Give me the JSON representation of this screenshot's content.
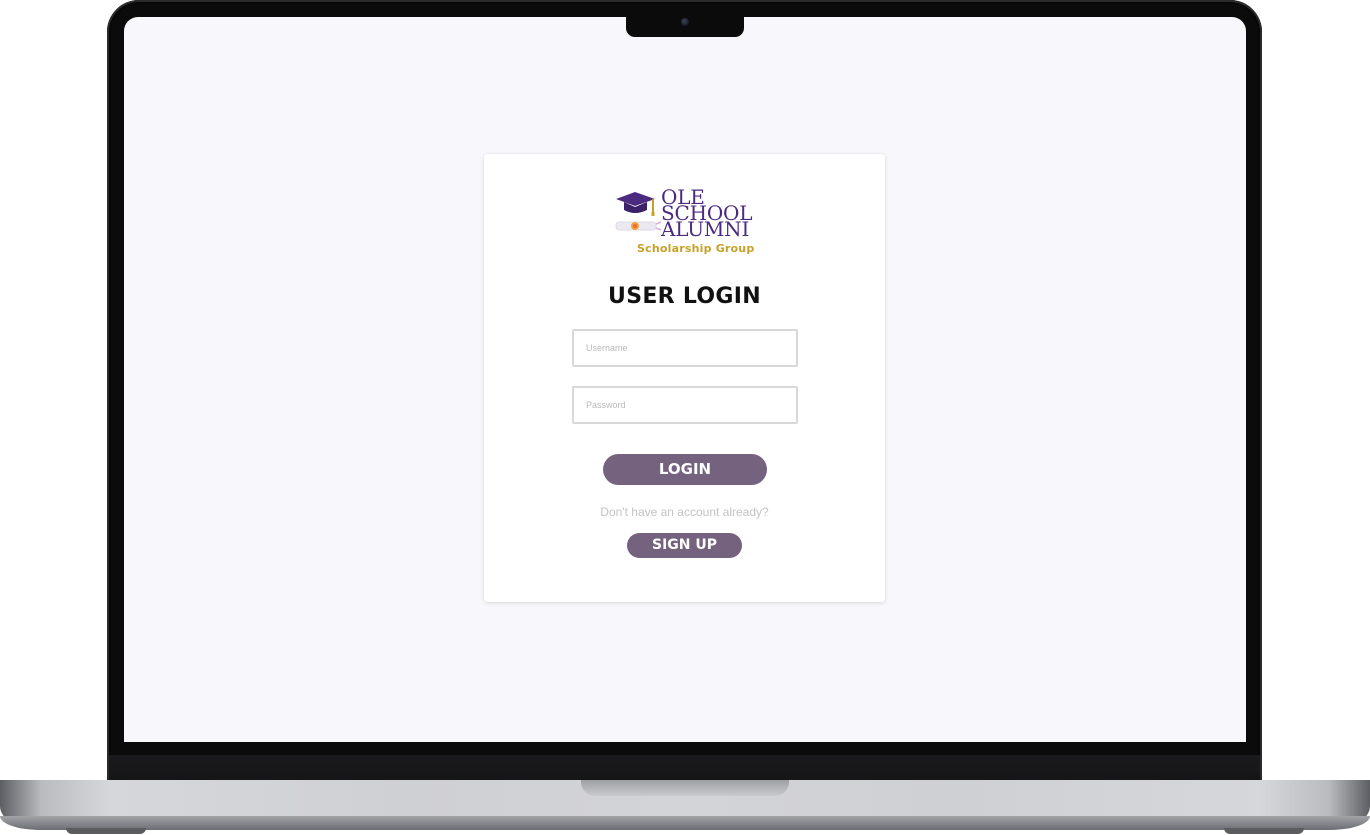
{
  "brand": {
    "line1": "OLE",
    "line2": "SCHOOL",
    "line3": "ALUMNI",
    "subtitle": "Scholarship Group",
    "colors": {
      "primary": "#4b2a80",
      "gold": "#c8a12a"
    },
    "icons": [
      "graduation-cap-icon",
      "diploma-scroll-icon"
    ]
  },
  "login": {
    "title": "USER LOGIN",
    "username_placeholder": "Username",
    "username_value": "",
    "password_placeholder": "Password",
    "password_value": "",
    "login_label": "LOGIN",
    "signup_prompt": "Don't have an account already?",
    "signup_label": "SIGN UP",
    "button_color": "#74627f"
  },
  "device": {
    "frame": "laptop",
    "icons": [
      "camera-icon"
    ]
  }
}
